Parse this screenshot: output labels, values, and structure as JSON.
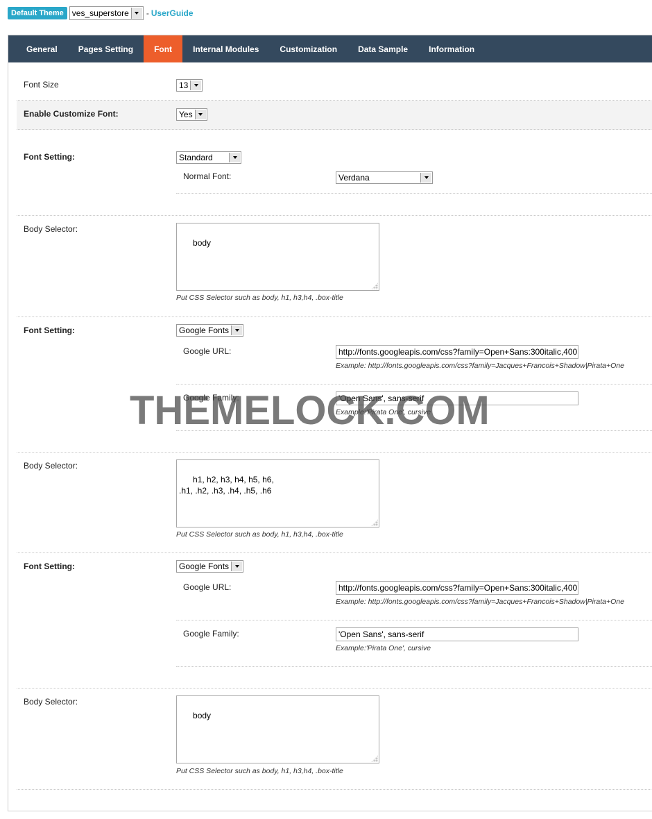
{
  "header": {
    "theme_badge": "Default Theme",
    "theme_select": "ves_superstore",
    "separator": "-",
    "guide_link": "UserGuide"
  },
  "tabs": [
    {
      "label": "General",
      "active": false
    },
    {
      "label": "Pages Setting",
      "active": false
    },
    {
      "label": "Font",
      "active": true
    },
    {
      "label": "Internal Modules",
      "active": false
    },
    {
      "label": "Customization",
      "active": false
    },
    {
      "label": "Data Sample",
      "active": false
    },
    {
      "label": "Information",
      "active": false
    }
  ],
  "colors": {
    "tab_bar": "#34495e",
    "tab_active": "#ed5e2b",
    "badge": "#2aa7c9"
  },
  "font_size": {
    "label": "Font Size",
    "value": "13"
  },
  "customize": {
    "label": "Enable Customize Font:",
    "value": "Yes"
  },
  "sections": [
    {
      "label": "Font Setting:",
      "type": "Standard",
      "normal_font_label": "Normal Font:",
      "normal_font": "Verdana",
      "selector_label": "Body Selector:",
      "selector": "body",
      "selector_hint": "Put CSS Selector such as body, h1, h3,h4, .box-title"
    },
    {
      "label": "Font Setting:",
      "type": "Google Fonts",
      "url_label": "Google URL:",
      "url": "http://fonts.googleapis.com/css?family=Open+Sans:300italic,400",
      "url_hint": "Example: http://fonts.googleapis.com/css?family=Jacques+Francois+Shadow|Pirata+One",
      "family_label": "Google Family:",
      "family": "'Open Sans', sans-serif",
      "family_hint": "Example:'Pirata One', cursive",
      "selector_label": "Body Selector:",
      "selector": "h1, h2, h3, h4, h5, h6,\n.h1, .h2, .h3, .h4, .h5, .h6",
      "selector_hint": "Put CSS Selector such as body, h1, h3,h4, .box-title"
    },
    {
      "label": "Font Setting:",
      "type": "Google Fonts",
      "url_label": "Google URL:",
      "url": "http://fonts.googleapis.com/css?family=Open+Sans:300italic,400",
      "url_hint": "Example: http://fonts.googleapis.com/css?family=Jacques+Francois+Shadow|Pirata+One",
      "family_label": "Google Family:",
      "family": "'Open Sans', sans-serif",
      "family_hint": "Example:'Pirata One', cursive",
      "selector_label": "Body Selector:",
      "selector": "body",
      "selector_hint": "Put CSS Selector such as body, h1, h3,h4, .box-title"
    }
  ],
  "watermark": "THEMELOCK.COM"
}
